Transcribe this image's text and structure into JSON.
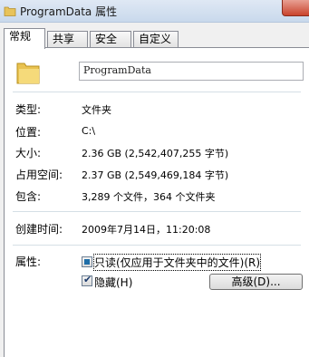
{
  "window": {
    "title": "ProgramData 属性"
  },
  "tabs": [
    {
      "label": "常规",
      "active": true
    },
    {
      "label": "共享",
      "active": false
    },
    {
      "label": "安全",
      "active": false
    },
    {
      "label": "自定义",
      "active": false
    }
  ],
  "general": {
    "icon": "folder-icon",
    "name": "ProgramData",
    "rows": [
      {
        "label": "类型:",
        "value": "文件夹"
      },
      {
        "label": "位置:",
        "value": "C:\\"
      },
      {
        "label": "大小:",
        "value": "2.36 GB (2,542,407,255 字节)"
      },
      {
        "label": "占用空间:",
        "value": "2.37 GB (2,549,469,184 字节)"
      },
      {
        "label": "包含:",
        "value": "3,289 个文件，364 个文件夹"
      }
    ],
    "created": {
      "label": "创建时间:",
      "value": "2009年7月14日，11:20:08"
    },
    "attributes": {
      "label": "属性:",
      "readonly": {
        "label": "只读(仅应用于文件夹中的文件)(R)",
        "state": "mixed"
      },
      "hidden": {
        "label": "隐藏(H)",
        "state": "checked"
      },
      "advanced_label": "高级(D)..."
    }
  }
}
